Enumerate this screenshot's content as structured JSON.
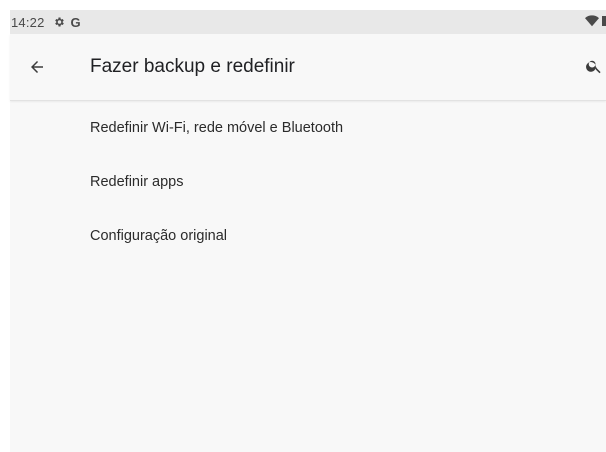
{
  "status_bar": {
    "time": "14:22",
    "icons": [
      "settings-gear-icon",
      "google-g-icon",
      "wifi-icon",
      "battery-icon"
    ],
    "google_letter": "G"
  },
  "app_bar": {
    "title": "Fazer backup e redefinir",
    "back_icon": "arrow-back-icon",
    "search_icon": "search-icon"
  },
  "options": [
    {
      "label": "Redefinir Wi-Fi, rede móvel e Bluetooth"
    },
    {
      "label": "Redefinir apps"
    },
    {
      "label": "Configuração original"
    }
  ],
  "colors": {
    "background": "#f8f8f8",
    "status_bar": "#e8e8e8",
    "text": "#202124"
  }
}
